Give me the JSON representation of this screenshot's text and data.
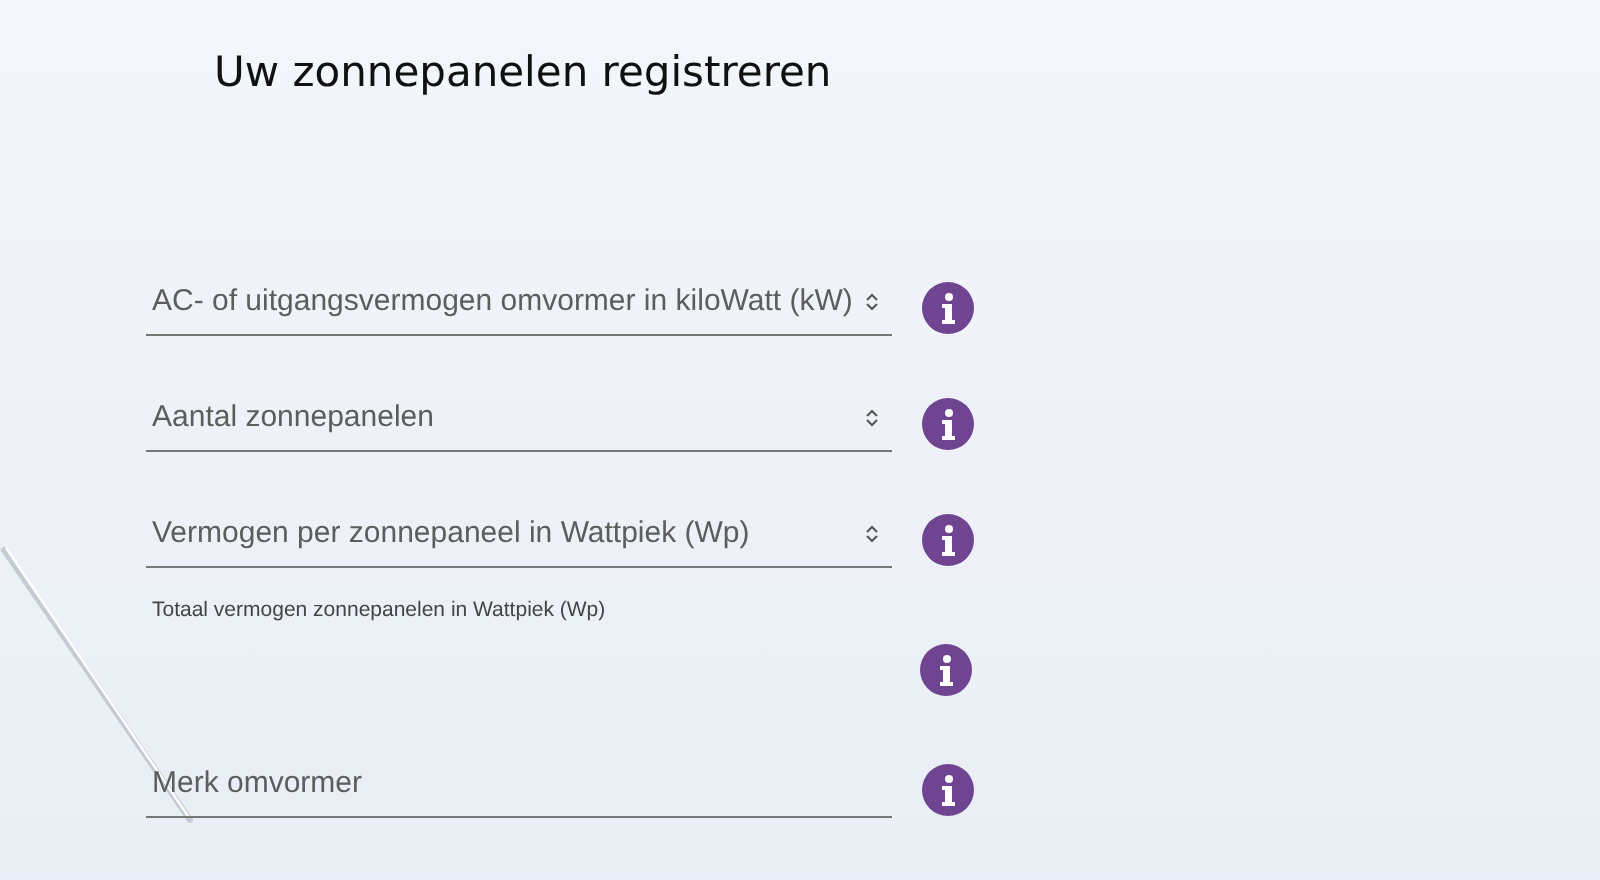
{
  "title": "Uw zonnepanelen registreren",
  "fields": [
    {
      "kind": "number",
      "placeholder": "AC- of uitgangsvermogen omvormer in kiloWatt (kW)"
    },
    {
      "kind": "number",
      "placeholder": "Aantal zonnepanelen"
    },
    {
      "kind": "number",
      "placeholder": "Vermogen per zonnepaneel in Wattpiek (Wp)"
    },
    {
      "kind": "readout",
      "label": "Totaal vermogen zonnepanelen in Wattpiek (Wp)"
    },
    {
      "kind": "text",
      "placeholder": "Merk omvormer"
    }
  ]
}
